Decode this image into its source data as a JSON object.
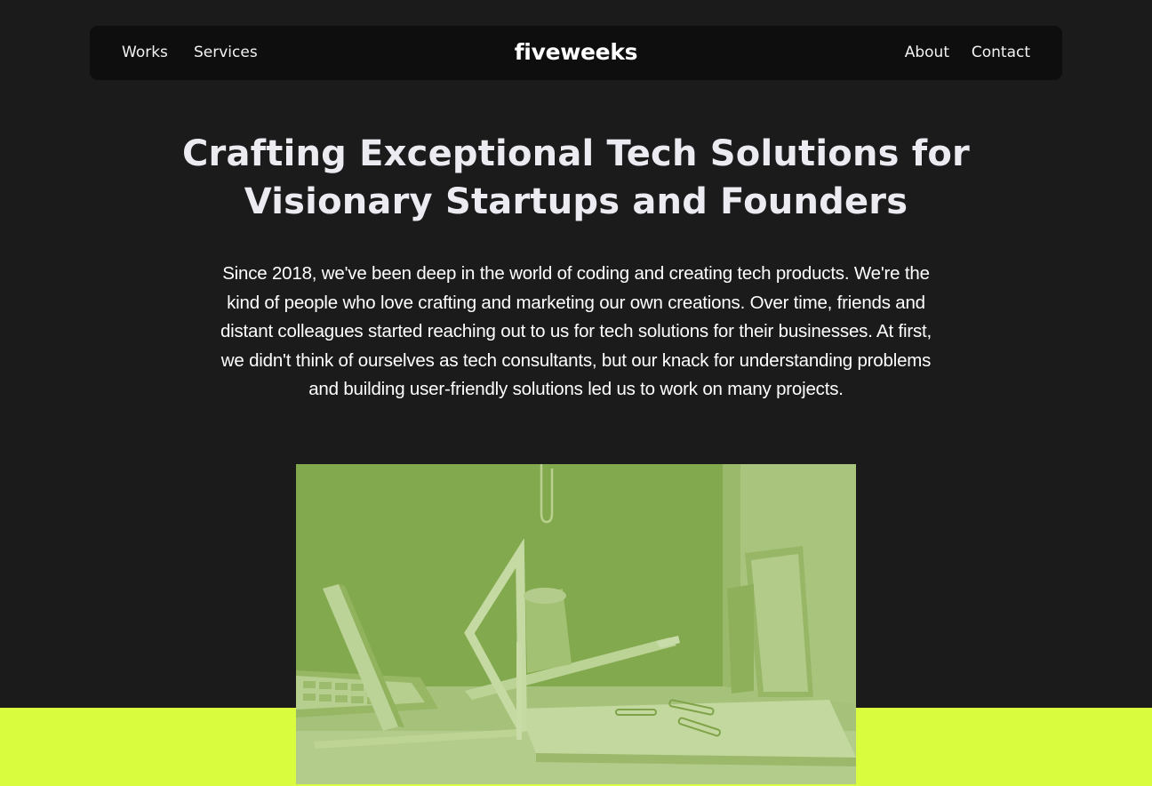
{
  "nav": {
    "works": "Works",
    "services": "Services",
    "logo": "fiveweeks",
    "about": "About",
    "contact": "Contact"
  },
  "hero": {
    "title": "Crafting Exceptional Tech Solutions for Visionary Startups and Founders",
    "body": "Since 2018, we've been deep in the world of coding and creating tech products. We're the kind of people who love crafting and marketing our own creations. Over time, friends and distant colleagues started reaching out to us for tech solutions for their businesses. At first, we didn't think of ourselves as tech consultants, but our knack for understanding problems and building user-friendly solutions led us to work on many projects."
  },
  "colors": {
    "background": "#1b1b1b",
    "navbar": "#0e0e0e",
    "accent": "#d9fc3e",
    "image_tint": "#8db258"
  }
}
